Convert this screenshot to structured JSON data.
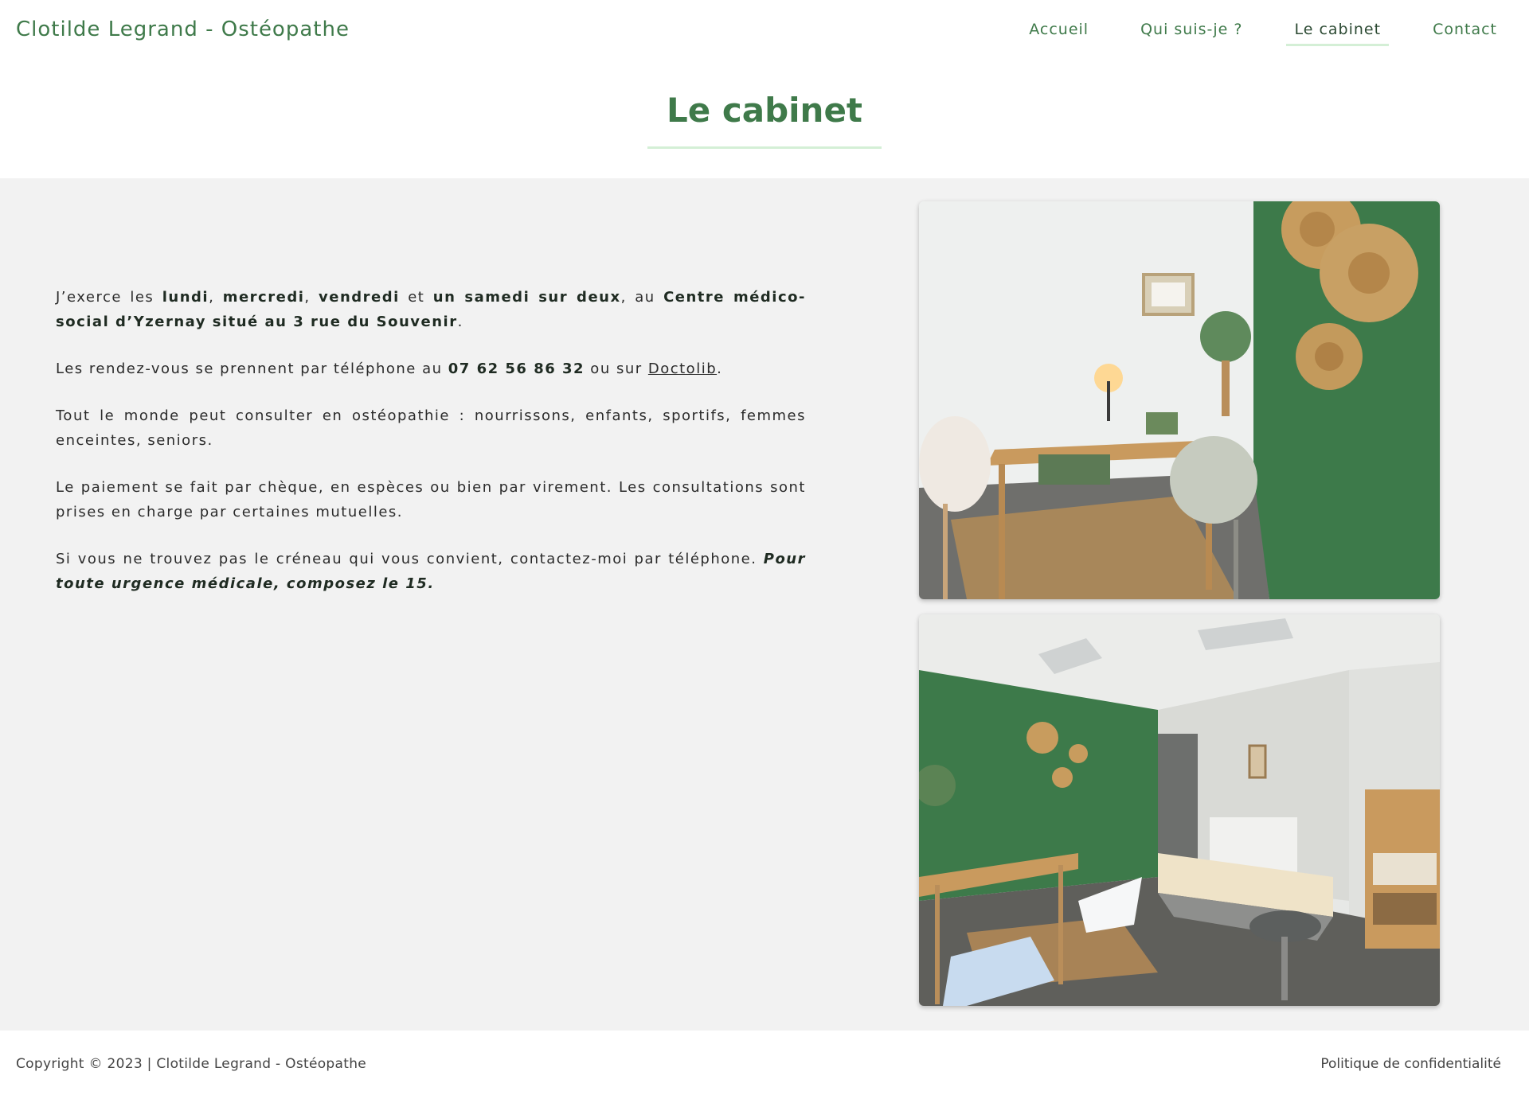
{
  "header": {
    "brand": "Clotilde Legrand - Ostéopathe",
    "nav": [
      {
        "label": "Accueil"
      },
      {
        "label": "Qui suis-je ?"
      },
      {
        "label": "Le cabinet"
      },
      {
        "label": "Contact"
      }
    ],
    "active_nav": "Le cabinet"
  },
  "page": {
    "title": "Le cabinet"
  },
  "content": {
    "p1": {
      "t1": "J’exerce les ",
      "b1": "lundi",
      "t2": ", ",
      "b2": "mercredi",
      "t3": ", ",
      "b3": "vendredi",
      "t4": " et ",
      "b4": "un samedi sur deux",
      "t5": ", au ",
      "b5": "Centre médico-social d’Yzernay situé au 3 rue du Souvenir",
      "t6": "."
    },
    "p2": {
      "t1": "Les rendez-vous se prennent par téléphone au ",
      "phone": "07 62 56 86 32",
      "t2": " ou sur ",
      "link": "Doctolib",
      "t3": "."
    },
    "p3": "Tout le monde peut consulter en ostéopathie : nourrissons, enfants, sportifs, femmes enceintes, seniors.",
    "p4": "Le paiement se fait par chèque, en espèces ou bien par virement. Les consultations sont prises en charge par certaines mutuelles.",
    "p5": {
      "t1": "Si vous ne trouvez pas le créneau qui vous convient, contactez-moi par téléphone. ",
      "emph": "Pour toute urgence médicale, composez le 15."
    }
  },
  "colors": {
    "brand_green": "#3f7a4a",
    "wall_green": "#3d7a4a",
    "accent_line": "#d4efd6",
    "section_bg": "#f2f2f2"
  },
  "footer": {
    "copyright": "Copyright © 2023 | Clotilde Legrand - Ostéopathe",
    "privacy": "Politique de confidentialité"
  }
}
